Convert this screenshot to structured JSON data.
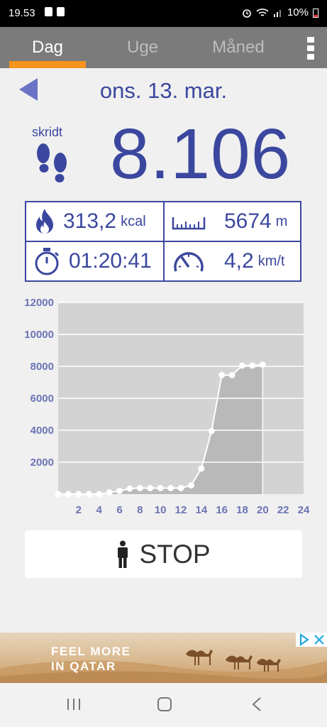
{
  "status_bar": {
    "time": "19.53",
    "battery": "10%"
  },
  "tabs": [
    {
      "label": "Dag",
      "active": true
    },
    {
      "label": "Uge",
      "active": false
    },
    {
      "label": "Måned",
      "active": false
    }
  ],
  "date": "ons. 13. mar.",
  "steps_label": "skridt",
  "steps_value": "8.106",
  "stats": {
    "calories": {
      "value": "313,2",
      "unit": "kcal",
      "icon": "flame-icon"
    },
    "distance": {
      "value": "5674",
      "unit": "m",
      "icon": "ruler-icon"
    },
    "duration": {
      "value": "01:20:41",
      "icon": "stopwatch-icon"
    },
    "speed": {
      "value": "4,2",
      "unit": "km/t",
      "icon": "speedometer-icon"
    }
  },
  "chart_data": {
    "type": "area",
    "x": [
      0,
      1,
      2,
      3,
      4,
      5,
      6,
      7,
      8,
      9,
      10,
      11,
      12,
      13,
      14,
      15,
      16,
      17,
      18,
      19,
      20
    ],
    "values": [
      0,
      0,
      0,
      0,
      0,
      100,
      200,
      350,
      380,
      380,
      380,
      380,
      380,
      550,
      1600,
      3950,
      7450,
      7450,
      8050,
      8050,
      8106
    ],
    "x_ticks": [
      "2",
      "4",
      "6",
      "8",
      "10",
      "12",
      "14",
      "16",
      "18",
      "20",
      "22",
      "24"
    ],
    "y_ticks": [
      "2000",
      "4000",
      "6000",
      "8000",
      "10000",
      "12000"
    ],
    "xlim": [
      0,
      24
    ],
    "ylim": [
      0,
      12000
    ],
    "grid": true,
    "colors": {
      "area": "#b9b9b9",
      "plot_bg": "#d3d3d3",
      "line": "#ffffff",
      "labels": "#6b73b5"
    }
  },
  "stop_button": {
    "label": "STOP"
  },
  "ad": {
    "line1": "FEEL MORE",
    "line2": "IN QATAR"
  },
  "colors": {
    "accent": "#f7941d",
    "primary": "#3b479e",
    "tabbar": "#7b7b7b"
  }
}
